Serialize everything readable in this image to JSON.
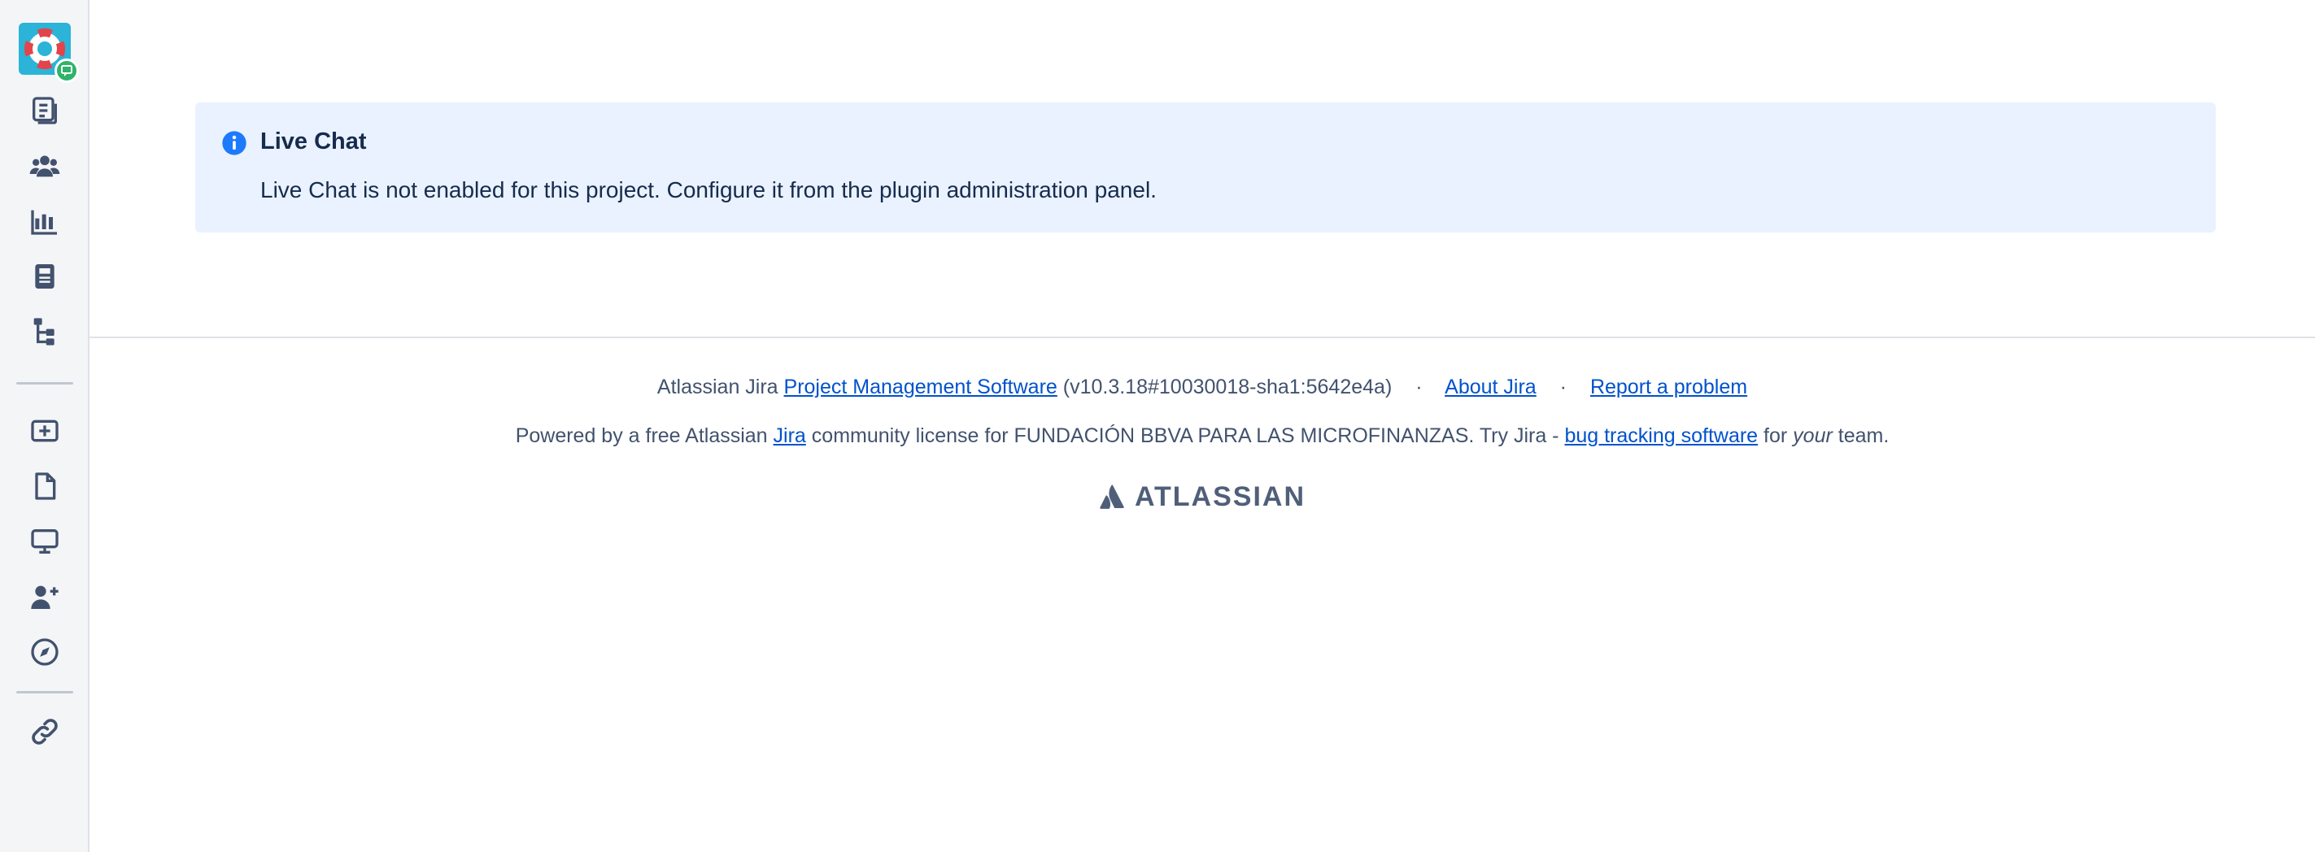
{
  "sidebar": {
    "logo_icon": "lifebuoy-chat-icon",
    "items": [
      {
        "name": "queues-icon"
      },
      {
        "name": "customers-icon"
      },
      {
        "name": "reports-icon"
      },
      {
        "name": "knowledge-base-icon"
      },
      {
        "name": "service-hierarchy-icon"
      },
      {
        "name": "raise-request-icon"
      },
      {
        "name": "page-icon"
      },
      {
        "name": "monitor-icon"
      },
      {
        "name": "add-user-icon"
      },
      {
        "name": "compass-icon"
      },
      {
        "name": "link-icon"
      }
    ]
  },
  "message": {
    "title": "Live Chat",
    "body": "Live Chat is not enabled for this project. Configure it from the plugin administration panel.",
    "accent": "#1d7afc",
    "background": "#e9f2fe"
  },
  "footer": {
    "line1": {
      "prefix": "Atlassian Jira",
      "pms_link": "Project Management Software",
      "version": "(v10.3.18#10030018-sha1:5642e4a)",
      "sep": "·",
      "about_link": "About Jira",
      "report_link": "Report a problem"
    },
    "line2": {
      "prefix": "Powered by a free Atlassian",
      "jira_link": "Jira",
      "middle": "community license for FUNDACIÓN BBVA PARA LAS MICROFINANZAS. Try Jira -",
      "bts_link": "bug tracking software",
      "for": "for",
      "your": "your",
      "suffix": "team."
    },
    "logo_text": "ATLASSIAN",
    "link_color": "#0052cc"
  }
}
